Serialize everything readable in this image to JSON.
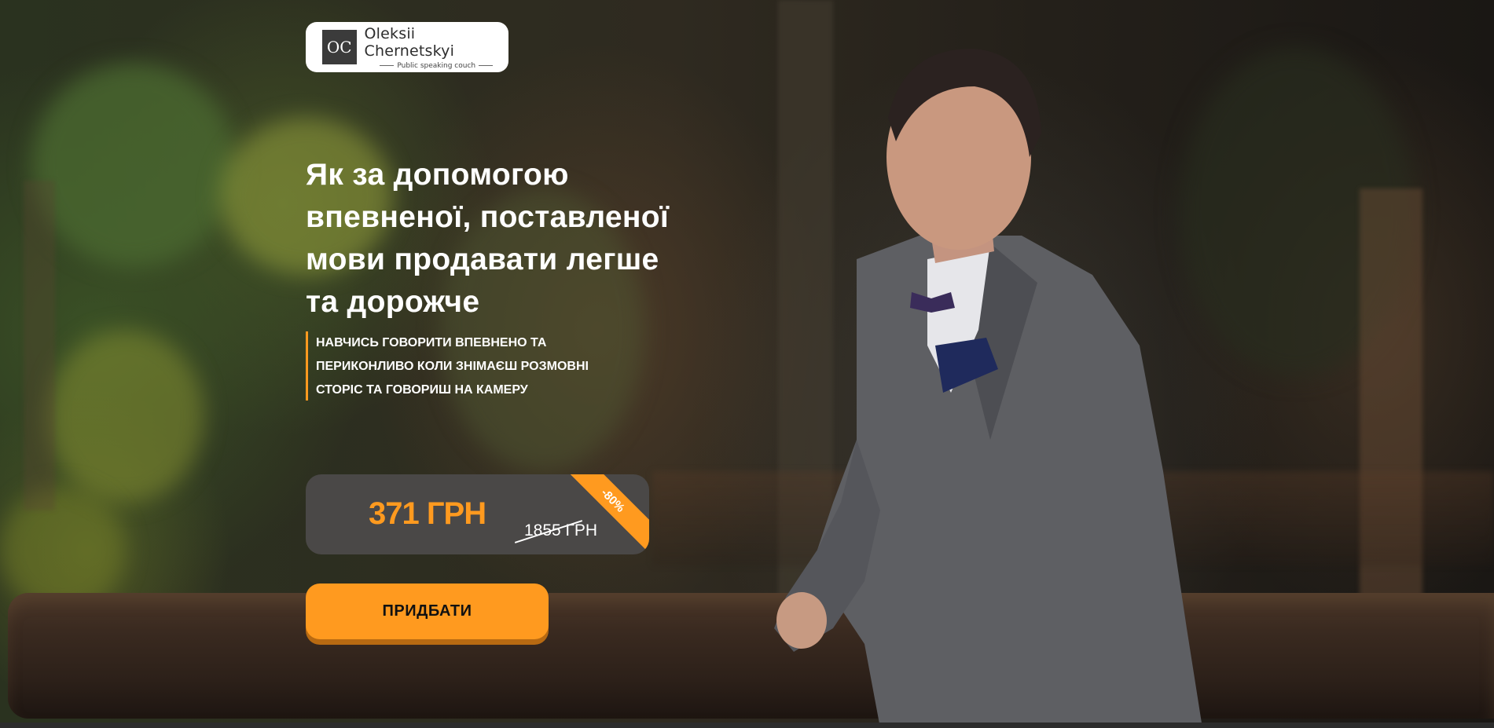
{
  "brand": {
    "logo_initials": "OC",
    "name": "Oleksii Chernetskyi",
    "tagline": "Public speaking couch"
  },
  "hero": {
    "headline_lines": [
      "Як за допомогою",
      "впевненої, поставленої",
      "мови продавати легше",
      "та дорожче"
    ],
    "subtitle_lines": [
      "НАВЧИСЬ ГОВОРИТИ ВПЕВНЕНО ТА",
      "ПЕРИКОНЛИВО КОЛИ ЗНІМАЄШ РОЗМОВНІ",
      "СТОРІС ТА ГОВОРИШ НА КАМЕРУ"
    ]
  },
  "pricing": {
    "new_price": "371 ГРН",
    "old_price_value": "1855",
    "old_price_currency": " ГРН",
    "discount": "-80%"
  },
  "cta": {
    "buy_label": "ПРИДБАТИ"
  },
  "colors": {
    "accent": "#ff9a1f",
    "price_box": "#4a4847",
    "headline": "#ffffff"
  },
  "background": {
    "photo_subject": "man-in-grey-suit-photo"
  }
}
